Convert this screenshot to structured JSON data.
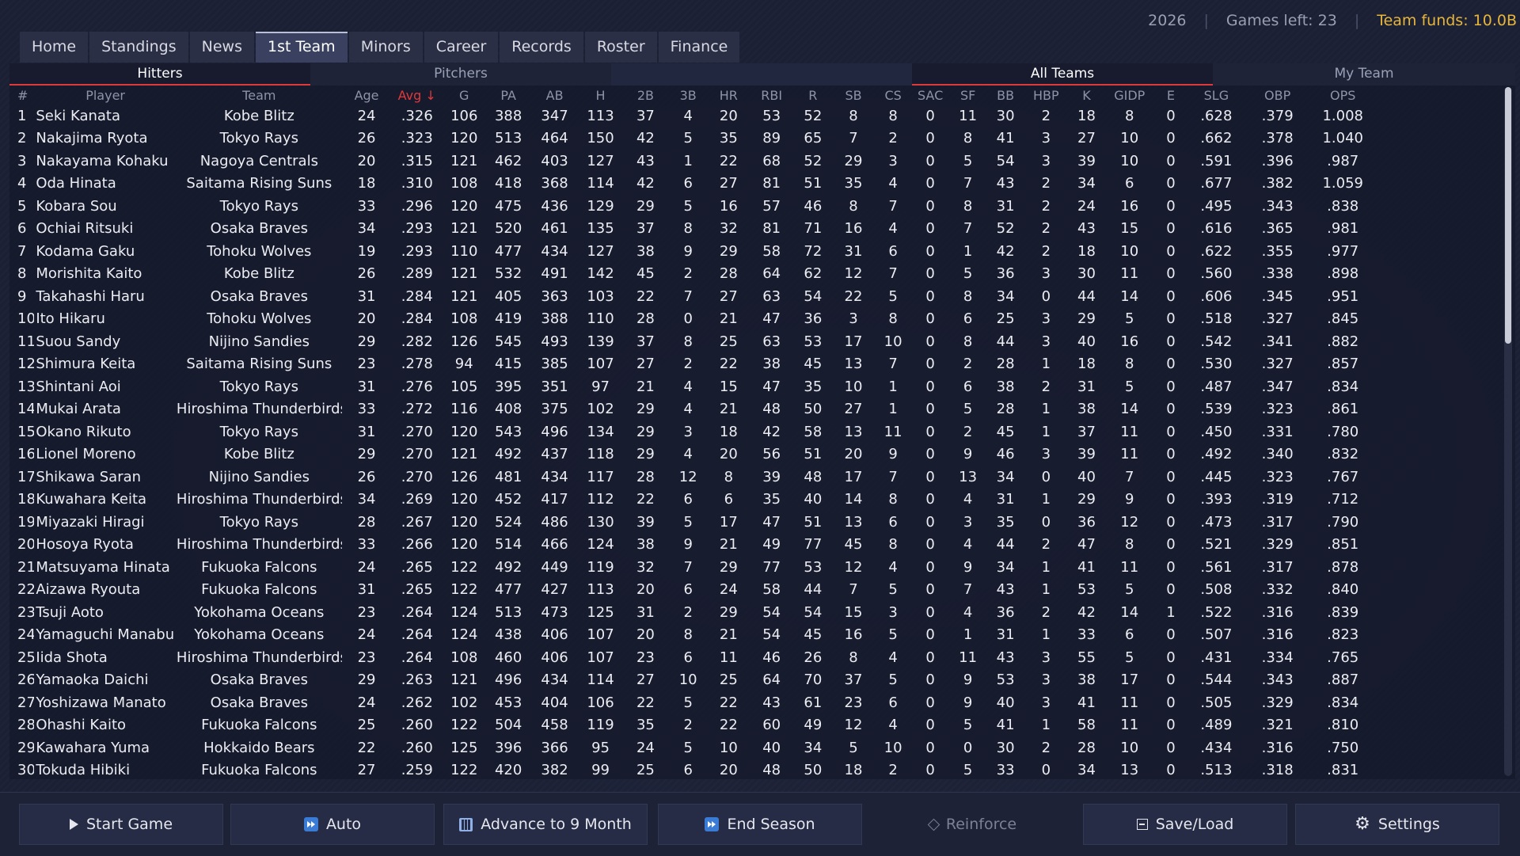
{
  "status": {
    "year": "2026",
    "games_left": "Games left: 23",
    "funds": "Team funds: 10.0B"
  },
  "nav": {
    "tabs": [
      "Home",
      "Standings",
      "News",
      "1st Team",
      "Minors",
      "Career",
      "Records",
      "Roster",
      "Finance"
    ],
    "active": "1st Team"
  },
  "subtabs": {
    "hitters": "Hitters",
    "pitchers": "Pitchers",
    "all_teams": "All Teams",
    "my_team": "My Team"
  },
  "table": {
    "columns": [
      "#",
      "Player",
      "Team",
      "Age",
      "Avg ↓",
      "G",
      "PA",
      "AB",
      "H",
      "2B",
      "3B",
      "HR",
      "RBI",
      "R",
      "SB",
      "CS",
      "SAC",
      "SF",
      "BB",
      "HBP",
      "K",
      "GIDP",
      "E",
      "SLG",
      "OBP",
      "OPS"
    ],
    "sorted_column": "Avg ↓",
    "rows": [
      [
        "1",
        "Seki Kanata",
        "Kobe Blitz",
        "24",
        ".326",
        "106",
        "388",
        "347",
        "113",
        "37",
        "4",
        "20",
        "53",
        "52",
        "8",
        "8",
        "0",
        "11",
        "30",
        "2",
        "18",
        "8",
        "0",
        ".628",
        ".379",
        "1.008"
      ],
      [
        "2",
        "Nakajima Ryota",
        "Tokyo Rays",
        "26",
        ".323",
        "120",
        "513",
        "464",
        "150",
        "42",
        "5",
        "35",
        "89",
        "65",
        "7",
        "2",
        "0",
        "8",
        "41",
        "3",
        "27",
        "10",
        "0",
        ".662",
        ".378",
        "1.040"
      ],
      [
        "3",
        "Nakayama Kohaku",
        "Nagoya Centrals",
        "20",
        ".315",
        "121",
        "462",
        "403",
        "127",
        "43",
        "1",
        "22",
        "68",
        "52",
        "29",
        "3",
        "0",
        "5",
        "54",
        "3",
        "39",
        "10",
        "0",
        ".591",
        ".396",
        ".987"
      ],
      [
        "4",
        "Oda Hinata",
        "Saitama Rising Suns",
        "18",
        ".310",
        "108",
        "418",
        "368",
        "114",
        "42",
        "6",
        "27",
        "81",
        "51",
        "35",
        "4",
        "0",
        "7",
        "43",
        "2",
        "34",
        "6",
        "0",
        ".677",
        ".382",
        "1.059"
      ],
      [
        "5",
        "Kobara Sou",
        "Tokyo Rays",
        "33",
        ".296",
        "120",
        "475",
        "436",
        "129",
        "29",
        "5",
        "16",
        "57",
        "46",
        "8",
        "7",
        "0",
        "8",
        "31",
        "2",
        "24",
        "16",
        "0",
        ".495",
        ".343",
        ".838"
      ],
      [
        "6",
        "Ochiai Ritsuki",
        "Osaka Braves",
        "34",
        ".293",
        "121",
        "520",
        "461",
        "135",
        "37",
        "8",
        "32",
        "81",
        "71",
        "16",
        "4",
        "0",
        "7",
        "52",
        "2",
        "43",
        "15",
        "0",
        ".616",
        ".365",
        ".981"
      ],
      [
        "7",
        "Kodama Gaku",
        "Tohoku Wolves",
        "19",
        ".293",
        "110",
        "477",
        "434",
        "127",
        "38",
        "9",
        "29",
        "58",
        "72",
        "31",
        "6",
        "0",
        "1",
        "42",
        "2",
        "18",
        "10",
        "0",
        ".622",
        ".355",
        ".977"
      ],
      [
        "8",
        "Morishita Kaito",
        "Kobe Blitz",
        "26",
        ".289",
        "121",
        "532",
        "491",
        "142",
        "45",
        "2",
        "28",
        "64",
        "62",
        "12",
        "7",
        "0",
        "5",
        "36",
        "3",
        "30",
        "11",
        "0",
        ".560",
        ".338",
        ".898"
      ],
      [
        "9",
        "Takahashi Haru",
        "Osaka Braves",
        "31",
        ".284",
        "121",
        "405",
        "363",
        "103",
        "22",
        "7",
        "27",
        "63",
        "54",
        "22",
        "5",
        "0",
        "8",
        "34",
        "0",
        "44",
        "14",
        "0",
        ".606",
        ".345",
        ".951"
      ],
      [
        "10",
        "Ito Hikaru",
        "Tohoku Wolves",
        "20",
        ".284",
        "108",
        "419",
        "388",
        "110",
        "28",
        "0",
        "21",
        "47",
        "36",
        "3",
        "8",
        "0",
        "6",
        "25",
        "3",
        "29",
        "5",
        "0",
        ".518",
        ".327",
        ".845"
      ],
      [
        "11",
        "Suou Sandy",
        "Nijino Sandies",
        "29",
        ".282",
        "126",
        "545",
        "493",
        "139",
        "37",
        "8",
        "25",
        "63",
        "53",
        "17",
        "10",
        "0",
        "8",
        "44",
        "3",
        "40",
        "16",
        "0",
        ".542",
        ".341",
        ".882"
      ],
      [
        "12",
        "Shimura Keita",
        "Saitama Rising Suns",
        "23",
        ".278",
        "94",
        "415",
        "385",
        "107",
        "27",
        "2",
        "22",
        "38",
        "45",
        "13",
        "7",
        "0",
        "2",
        "28",
        "1",
        "18",
        "8",
        "0",
        ".530",
        ".327",
        ".857"
      ],
      [
        "13",
        "Shintani Aoi",
        "Tokyo Rays",
        "31",
        ".276",
        "105",
        "395",
        "351",
        "97",
        "21",
        "4",
        "15",
        "47",
        "35",
        "10",
        "1",
        "0",
        "6",
        "38",
        "2",
        "31",
        "5",
        "0",
        ".487",
        ".347",
        ".834"
      ],
      [
        "14",
        "Mukai Arata",
        "Hiroshima Thunderbirds",
        "33",
        ".272",
        "116",
        "408",
        "375",
        "102",
        "29",
        "4",
        "21",
        "48",
        "50",
        "27",
        "1",
        "0",
        "5",
        "28",
        "1",
        "38",
        "14",
        "0",
        ".539",
        ".323",
        ".861"
      ],
      [
        "15",
        "Okano Rikuto",
        "Tokyo Rays",
        "31",
        ".270",
        "120",
        "543",
        "496",
        "134",
        "29",
        "3",
        "18",
        "42",
        "58",
        "13",
        "11",
        "0",
        "2",
        "45",
        "1",
        "37",
        "11",
        "0",
        ".450",
        ".331",
        ".780"
      ],
      [
        "16",
        "Lionel Moreno",
        "Kobe Blitz",
        "29",
        ".270",
        "121",
        "492",
        "437",
        "118",
        "29",
        "4",
        "20",
        "56",
        "51",
        "20",
        "9",
        "0",
        "9",
        "46",
        "3",
        "39",
        "11",
        "0",
        ".492",
        ".340",
        ".832"
      ],
      [
        "17",
        "Shikawa Saran",
        "Nijino Sandies",
        "26",
        ".270",
        "126",
        "481",
        "434",
        "117",
        "28",
        "12",
        "8",
        "39",
        "48",
        "17",
        "7",
        "0",
        "13",
        "34",
        "0",
        "40",
        "7",
        "0",
        ".445",
        ".323",
        ".767"
      ],
      [
        "18",
        "Kuwahara Keita",
        "Hiroshima Thunderbirds",
        "34",
        ".269",
        "120",
        "452",
        "417",
        "112",
        "22",
        "6",
        "6",
        "35",
        "40",
        "14",
        "8",
        "0",
        "4",
        "31",
        "1",
        "29",
        "9",
        "0",
        ".393",
        ".319",
        ".712"
      ],
      [
        "19",
        "Miyazaki Hiragi",
        "Tokyo Rays",
        "28",
        ".267",
        "120",
        "524",
        "486",
        "130",
        "39",
        "5",
        "17",
        "47",
        "51",
        "13",
        "6",
        "0",
        "3",
        "35",
        "0",
        "36",
        "12",
        "0",
        ".473",
        ".317",
        ".790"
      ],
      [
        "20",
        "Hosoya Ryota",
        "Hiroshima Thunderbirds",
        "33",
        ".266",
        "120",
        "514",
        "466",
        "124",
        "38",
        "9",
        "21",
        "49",
        "77",
        "45",
        "8",
        "0",
        "4",
        "44",
        "2",
        "47",
        "8",
        "0",
        ".521",
        ".329",
        ".851"
      ],
      [
        "21",
        "Matsuyama Hinata",
        "Fukuoka Falcons",
        "24",
        ".265",
        "122",
        "492",
        "449",
        "119",
        "32",
        "7",
        "29",
        "77",
        "53",
        "12",
        "4",
        "0",
        "9",
        "34",
        "1",
        "41",
        "11",
        "0",
        ".561",
        ".317",
        ".878"
      ],
      [
        "22",
        "Aizawa Ryouta",
        "Fukuoka Falcons",
        "31",
        ".265",
        "122",
        "477",
        "427",
        "113",
        "20",
        "6",
        "24",
        "58",
        "44",
        "7",
        "5",
        "0",
        "7",
        "43",
        "1",
        "53",
        "5",
        "0",
        ".508",
        ".332",
        ".840"
      ],
      [
        "23",
        "Tsuji Aoto",
        "Yokohama Oceans",
        "23",
        ".264",
        "124",
        "513",
        "473",
        "125",
        "31",
        "2",
        "29",
        "54",
        "54",
        "15",
        "3",
        "0",
        "4",
        "36",
        "2",
        "42",
        "14",
        "1",
        ".522",
        ".316",
        ".839"
      ],
      [
        "24",
        "Yamaguchi Manabu",
        "Yokohama Oceans",
        "24",
        ".264",
        "124",
        "438",
        "406",
        "107",
        "20",
        "8",
        "21",
        "54",
        "45",
        "16",
        "5",
        "0",
        "1",
        "31",
        "1",
        "33",
        "6",
        "0",
        ".507",
        ".316",
        ".823"
      ],
      [
        "25",
        "Iida Shota",
        "Hiroshima Thunderbirds",
        "23",
        ".264",
        "108",
        "460",
        "406",
        "107",
        "23",
        "6",
        "11",
        "46",
        "26",
        "8",
        "4",
        "0",
        "11",
        "43",
        "3",
        "55",
        "5",
        "0",
        ".431",
        ".334",
        ".765"
      ],
      [
        "26",
        "Yamaoka Daichi",
        "Osaka Braves",
        "29",
        ".263",
        "121",
        "496",
        "434",
        "114",
        "27",
        "10",
        "25",
        "64",
        "70",
        "37",
        "5",
        "0",
        "9",
        "53",
        "3",
        "38",
        "17",
        "0",
        ".544",
        ".343",
        ".887"
      ],
      [
        "27",
        "Yoshizawa Manato",
        "Osaka Braves",
        "24",
        ".262",
        "102",
        "453",
        "404",
        "106",
        "22",
        "5",
        "22",
        "43",
        "61",
        "23",
        "6",
        "0",
        "9",
        "40",
        "3",
        "41",
        "11",
        "0",
        ".505",
        ".329",
        ".834"
      ],
      [
        "28",
        "Ohashi Kaito",
        "Fukuoka Falcons",
        "25",
        ".260",
        "122",
        "504",
        "458",
        "119",
        "35",
        "2",
        "22",
        "60",
        "49",
        "12",
        "4",
        "0",
        "5",
        "41",
        "1",
        "58",
        "11",
        "0",
        ".489",
        ".321",
        ".810"
      ],
      [
        "29",
        "Kawahara Yuma",
        "Hokkaido Bears",
        "22",
        ".260",
        "125",
        "396",
        "366",
        "95",
        "24",
        "5",
        "10",
        "40",
        "34",
        "5",
        "10",
        "0",
        "0",
        "30",
        "2",
        "28",
        "10",
        "0",
        ".434",
        ".316",
        ".750"
      ],
      [
        "30",
        "Tokuda Hibiki",
        "Fukuoka Falcons",
        "27",
        ".259",
        "122",
        "420",
        "382",
        "99",
        "25",
        "6",
        "20",
        "48",
        "50",
        "18",
        "2",
        "0",
        "5",
        "33",
        "0",
        "34",
        "13",
        "0",
        ".513",
        ".318",
        ".831"
      ]
    ]
  },
  "buttons": {
    "start_game": "Start Game",
    "auto": "Auto",
    "advance": "Advance to 9 Month",
    "end_season": "End Season",
    "reinforce": "Reinforce",
    "save_load": "Save/Load",
    "settings": "Settings"
  },
  "icons": {
    "start_game": "play-icon",
    "auto": "fast-forward-icon",
    "advance": "calendar-icon",
    "end_season": "skip-icon",
    "reinforce": "diamond-icon",
    "save_load": "save-icon",
    "settings": "gear-icon"
  },
  "colors": {
    "accent_red": "#e0393b",
    "funds_gold": "#e6b53a",
    "background": "#1b2035"
  }
}
